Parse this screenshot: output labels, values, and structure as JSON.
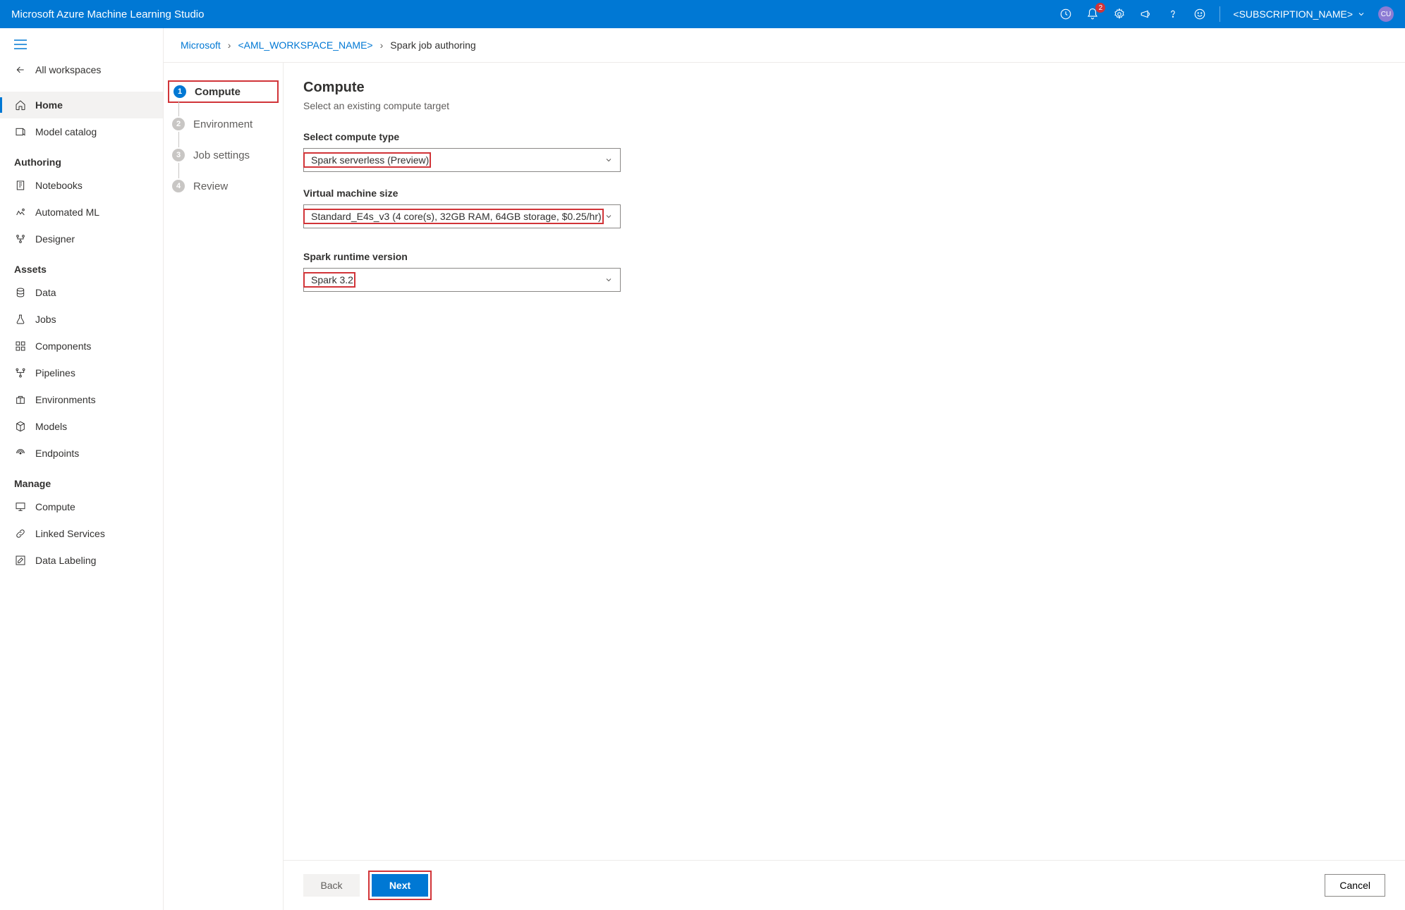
{
  "header": {
    "title": "Microsoft Azure Machine Learning Studio",
    "notification_count": "2",
    "subscription_label": "<SUBSCRIPTION_NAME>",
    "avatar_initials": "CU"
  },
  "sidebar": {
    "all_workspaces": "All workspaces",
    "home": "Home",
    "model_catalog": "Model catalog",
    "sections": {
      "authoring": {
        "title": "Authoring",
        "items": [
          "Notebooks",
          "Automated ML",
          "Designer"
        ]
      },
      "assets": {
        "title": "Assets",
        "items": [
          "Data",
          "Jobs",
          "Components",
          "Pipelines",
          "Environments",
          "Models",
          "Endpoints"
        ]
      },
      "manage": {
        "title": "Manage",
        "items": [
          "Compute",
          "Linked Services",
          "Data Labeling"
        ]
      }
    }
  },
  "breadcrumb": {
    "root": "Microsoft",
    "workspace": "<AML_WORKSPACE_NAME>",
    "current": "Spark job authoring"
  },
  "stepper": {
    "steps": [
      "Compute",
      "Environment",
      "Job settings",
      "Review"
    ]
  },
  "form": {
    "title": "Compute",
    "subtitle": "Select an existing compute target",
    "compute_type_label": "Select compute type",
    "compute_type_value": "Spark serverless (Preview)",
    "vm_size_label": "Virtual machine size",
    "vm_size_value": "Standard_E4s_v3 (4 core(s), 32GB RAM, 64GB storage, $0.25/hr)",
    "runtime_label": "Spark runtime version",
    "runtime_value": "Spark 3.2"
  },
  "footer": {
    "back": "Back",
    "next": "Next",
    "cancel": "Cancel"
  }
}
